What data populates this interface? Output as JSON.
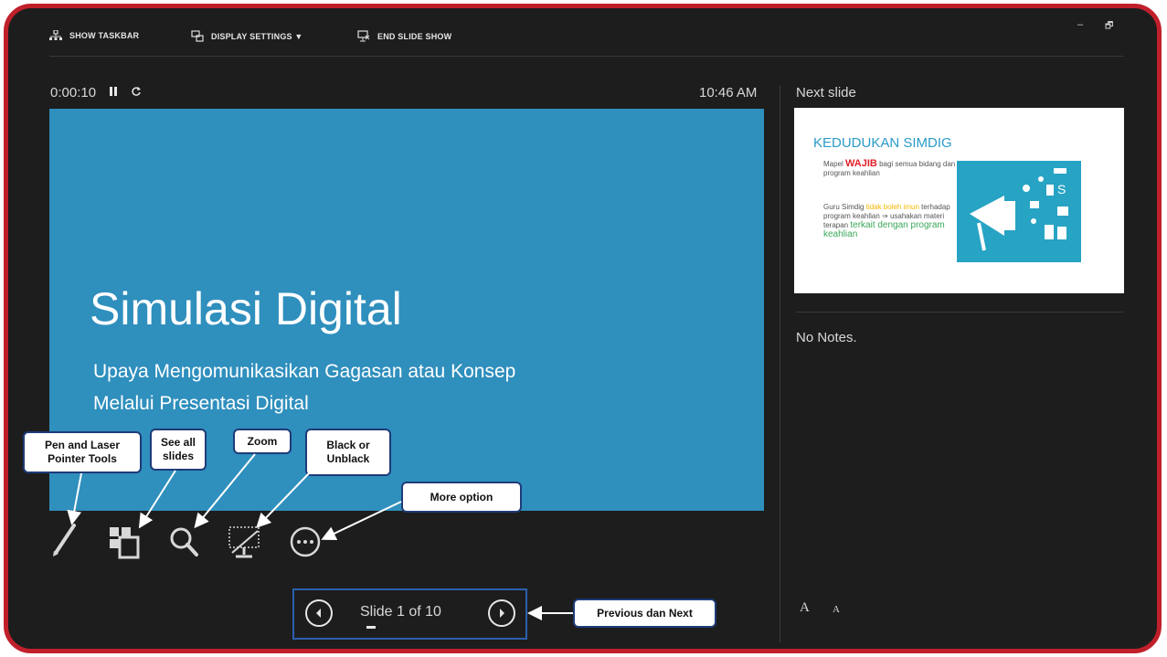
{
  "toolbar": {
    "show_taskbar": "SHOW TASKBAR",
    "display_settings": "DISPLAY SETTINGS ▼",
    "end_slide_show": "END SLIDE SHOW",
    "minimize": "–",
    "restore": "🗗"
  },
  "presenter": {
    "timer": "0:00:10",
    "clock": "10:46 AM",
    "next_slide_label": "Next slide",
    "notes": "No Notes."
  },
  "current_slide": {
    "title": "Simulasi Digital",
    "subtitle_line1": "Upaya Mengomunikasikan Gagasan atau Konsep",
    "subtitle_line2": "Melalui Presentasi Digital",
    "background": "#2f8fbd"
  },
  "next_slide": {
    "title": "KEDUDUKAN SIMDIG",
    "p1_pre": "Mapel ",
    "p1_em": "WAJIB",
    "p1_post": " bagi semua bidang dan program keahlian",
    "p2_pre": "Guru Simdig ",
    "p2_em": "tidak boleh imun",
    "p2_mid": " terhadap program keahlian ⇒ usahakan materi terapan ",
    "p2_green": "terkait dengan program keahlian"
  },
  "navigation": {
    "slide_count": "Slide 1 of 10"
  },
  "font_controls": {
    "increase": "A",
    "decrease": "A"
  },
  "callouts": {
    "pen": "Pen and Laser Pointer Tools",
    "see_all": "See all slides",
    "zoom": "Zoom",
    "black": "Black or Unblack",
    "more": "More option",
    "prev_next": "Previous dan Next"
  },
  "icons": [
    "taskbar-icon",
    "display-settings-icon",
    "end-show-icon",
    "pause-icon",
    "restart-icon",
    "pen-icon",
    "see-all-slides-icon",
    "zoom-icon",
    "black-screen-icon",
    "more-options-icon",
    "previous-icon",
    "next-icon"
  ],
  "colors": {
    "frame_border": "#c0202b",
    "background": "#1d1d1d",
    "slide_blue": "#2f8fbd",
    "nav_highlight": "#2c5fb0"
  }
}
